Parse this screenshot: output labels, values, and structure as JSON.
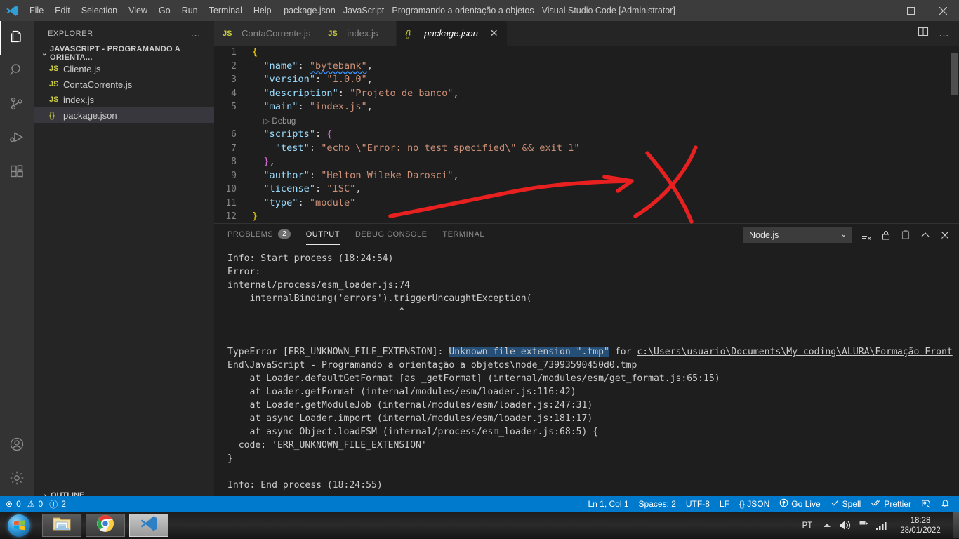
{
  "titlebar": {
    "title": "package.json - JavaScript - Programando a orientação a objetos - Visual Studio Code [Administrator]",
    "menus": [
      "File",
      "Edit",
      "Selection",
      "View",
      "Go",
      "Run",
      "Terminal",
      "Help"
    ],
    "minimize": "─",
    "maximize": "▢",
    "close": "✕"
  },
  "activitybar": {
    "items": [
      {
        "name": "explorer",
        "icon": "files-icon"
      },
      {
        "name": "search",
        "icon": "search-icon"
      },
      {
        "name": "source-control",
        "icon": "source-control-icon"
      },
      {
        "name": "run-and-debug",
        "icon": "run-debug-icon"
      },
      {
        "name": "extensions",
        "icon": "extensions-icon"
      }
    ],
    "bottom": [
      {
        "name": "accounts",
        "icon": "account-icon"
      },
      {
        "name": "settings",
        "icon": "gear-icon"
      }
    ]
  },
  "sidebar": {
    "header": "EXPLORER",
    "more_actions": "…",
    "root_folder": "JAVASCRIPT - PROGRAMANDO A ORIENTA...",
    "files": [
      {
        "name": "Cliente.js",
        "icon": "JS",
        "type": "js",
        "selected": false
      },
      {
        "name": "ContaCorrente.js",
        "icon": "JS",
        "type": "js",
        "selected": false
      },
      {
        "name": "index.js",
        "icon": "JS",
        "type": "js",
        "selected": false
      },
      {
        "name": "package.json",
        "icon": "{}",
        "type": "json",
        "selected": true
      }
    ],
    "outline": "OUTLINE"
  },
  "tabs": [
    {
      "label": "ContaCorrente.js",
      "icon": "JS",
      "type": "js",
      "active": false
    },
    {
      "label": "index.js",
      "icon": "JS",
      "type": "js",
      "active": false
    },
    {
      "label": "package.json",
      "icon": "{}",
      "type": "json",
      "active": true,
      "close": "✕"
    }
  ],
  "tab_actions": {
    "split": "split-editor-icon",
    "more": "…"
  },
  "editor": {
    "filename": "package.json",
    "codelens": "▷ Debug",
    "lines": [
      {
        "n": "1",
        "html": "<span class='k-brace'>{</span>"
      },
      {
        "n": "2",
        "html": "  <span class='k-key'>\"name\"</span><span class='k-pun'>:</span> <span class='k-str squiggle'>\"bytebank\"</span><span class='k-pun'>,</span>"
      },
      {
        "n": "3",
        "html": "  <span class='k-key'>\"version\"</span><span class='k-pun'>:</span> <span class='k-str'>\"1.0.0\"</span><span class='k-pun'>,</span>"
      },
      {
        "n": "4",
        "html": "  <span class='k-key'>\"description\"</span><span class='k-pun'>:</span> <span class='k-str'>\"Projeto de banco\"</span><span class='k-pun'>,</span>"
      },
      {
        "n": "5",
        "html": "  <span class='k-key'>\"main\"</span><span class='k-pun'>:</span> <span class='k-str'>\"index.js\"</span><span class='k-pun'>,</span>"
      },
      {
        "n": "",
        "html": "  <span class='codelens'>▷ Debug</span>"
      },
      {
        "n": "6",
        "html": "  <span class='k-key'>\"scripts\"</span><span class='k-pun'>:</span> <span class='k-brace2'>{</span>"
      },
      {
        "n": "7",
        "html": "    <span class='k-key'>\"test\"</span><span class='k-pun'>:</span> <span class='k-str'>\"echo \\\"Error: no test specified\\\" &amp;&amp; exit 1\"</span>"
      },
      {
        "n": "8",
        "html": "  <span class='k-brace2'>}</span><span class='k-pun'>,</span>"
      },
      {
        "n": "9",
        "html": "  <span class='k-key'>\"author\"</span><span class='k-pun'>:</span> <span class='k-str'>\"Helton Wileke Darosci\"</span><span class='k-pun'>,</span>"
      },
      {
        "n": "10",
        "html": "  <span class='k-key'>\"license\"</span><span class='k-pun'>:</span> <span class='k-str'>\"ISC\"</span><span class='k-pun'>,</span>"
      },
      {
        "n": "11",
        "html": "  <span class='k-key'>\"type\"</span><span class='k-pun'>:</span> <span class='k-str'>\"module\"</span>"
      },
      {
        "n": "12",
        "html": "<span class='k-brace'>}</span>"
      }
    ]
  },
  "panel": {
    "tabs": [
      {
        "label": "PROBLEMS",
        "badge": "2",
        "active": false
      },
      {
        "label": "OUTPUT",
        "badge": "",
        "active": true
      },
      {
        "label": "DEBUG CONSOLE",
        "badge": "",
        "active": false
      },
      {
        "label": "TERMINAL",
        "badge": "",
        "active": false
      }
    ],
    "channel_select": "Node.js",
    "chevron_down": "⌄",
    "actions": [
      {
        "name": "clear-output-icon",
        "glyph": "≡"
      },
      {
        "name": "lock-scroll-icon",
        "glyph": "🔒"
      },
      {
        "name": "open-in-editor-icon",
        "glyph": "⧉"
      },
      {
        "name": "maximize-panel-icon",
        "glyph": "^"
      },
      {
        "name": "close-panel-icon",
        "glyph": "✕"
      }
    ],
    "output_lines": [
      {
        "text": "Info: Start process (18:24:54)"
      },
      {
        "text": "Error:"
      },
      {
        "text": "internal/process/esm_loader.js:74"
      },
      {
        "text": "    internalBinding('errors').triggerUncaughtException("
      },
      {
        "text": "                               ^"
      },
      {
        "text": ""
      },
      {
        "text": ""
      },
      {
        "text": "TypeError [ERR_UNKNOWN_FILE_EXTENSION]: Unknown file extension \".tmp\" for c:\\Users\\usuario\\Documents\\My coding\\ALURA\\Formação Front"
      },
      {
        "text": "End\\JavaScript - Programando a orientação a objetos\\node_73993590450d0.tmp"
      },
      {
        "text": "    at Loader.defaultGetFormat [as _getFormat] (internal/modules/esm/get_format.js:65:15)"
      },
      {
        "text": "    at Loader.getFormat (internal/modules/esm/loader.js:116:42)"
      },
      {
        "text": "    at Loader.getModuleJob (internal/modules/esm/loader.js:247:31)"
      },
      {
        "text": "    at async Loader.import (internal/modules/esm/loader.js:181:17)"
      },
      {
        "text": "    at async Object.loadESM (internal/process/esm_loader.js:68:5) {"
      },
      {
        "text": "  code: 'ERR_UNKNOWN_FILE_EXTENSION'"
      },
      {
        "text": "}"
      },
      {
        "text": ""
      },
      {
        "text": "Info: End process (18:24:55)"
      }
    ],
    "highlighted_text": "Unknown file extension \".tmp\"",
    "linked_path": "c:\\Users\\usuario\\Documents\\My coding\\ALURA\\Formação Front"
  },
  "statusbar": {
    "errors": "0",
    "warnings": "0",
    "infos": "2",
    "error_icon": "⊗",
    "warning_icon": "⚠",
    "info_icon": "ⓘ",
    "right": [
      {
        "name": "cursor-position",
        "label": "Ln 1, Col 1"
      },
      {
        "name": "indentation",
        "label": "Spaces: 2"
      },
      {
        "name": "encoding",
        "label": "UTF-8"
      },
      {
        "name": "eol",
        "label": "LF"
      },
      {
        "name": "language-mode",
        "label": "{} JSON"
      },
      {
        "name": "go-live",
        "label": "Go Live",
        "icon": "broadcast-icon"
      },
      {
        "name": "spell-checker",
        "label": "Spell",
        "icon": "check-icon"
      },
      {
        "name": "prettier",
        "label": "Prettier",
        "icon": "double-check-icon"
      },
      {
        "name": "remote-feedback",
        "label": "",
        "icon": "feedback-icon"
      },
      {
        "name": "notifications",
        "label": "",
        "icon": "bell-icon"
      }
    ]
  },
  "taskbar": {
    "start": "start-orb",
    "items": [
      {
        "name": "file-explorer",
        "icon": "folder-icon",
        "active": false
      },
      {
        "name": "google-chrome",
        "icon": "chrome-icon",
        "active": false
      },
      {
        "name": "visual-studio-code",
        "icon": "vscode-icon",
        "active": true
      }
    ],
    "tray": {
      "language": "PT",
      "show_hidden": "▲",
      "volume": "volume-icon",
      "network": "network-icon",
      "signal": "signal-icon",
      "time": "18:28",
      "date": "28/01/2022"
    }
  },
  "annotation": {
    "arrow_color": "#e8201f",
    "shapes": [
      "arrow-pointing-right",
      "cross-mark-x"
    ]
  }
}
